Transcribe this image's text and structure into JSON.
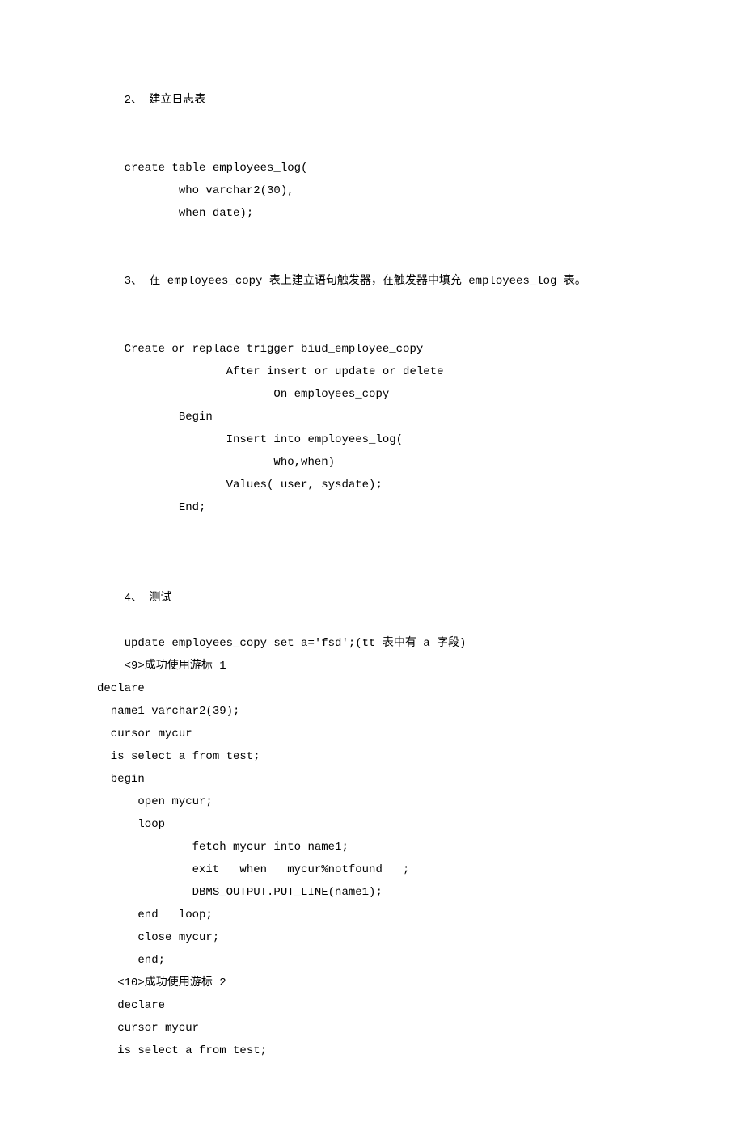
{
  "lines": {
    "l01": "    2、 建立日志表",
    "l02": "    create table employees_log(",
    "l03": "            who varchar2(30),",
    "l04": "            when date);",
    "l05": "    3、 在 employees_copy 表上建立语句触发器，在触发器中填充 employees_log 表。",
    "l06": "    Create or replace trigger biud_employee_copy",
    "l07": "                   After insert or update or delete",
    "l08": "                          On employees_copy",
    "l09": "            Begin",
    "l10": "                   Insert into employees_log(",
    "l11": "                          Who,when)",
    "l12": "                   Values( user, sysdate);",
    "l13": "            End;",
    "l14": "    4、 测试",
    "l15": "    update employees_copy set a='fsd';(tt 表中有 a 字段)",
    "l16": "    <9>成功使用游标 1",
    "l17": "declare",
    "l18": "  name1 varchar2(39);",
    "l19": "  cursor mycur",
    "l20": "  is select a from test;",
    "l21": "  begin",
    "l22": "      open mycur;",
    "l23": "      loop",
    "l24": "              fetch mycur into name1;",
    "l25": "              exit   when   mycur%notfound   ;",
    "l26": "              DBMS_OUTPUT.PUT_LINE(name1);",
    "l27": "      end   loop;",
    "l28": "      close mycur;",
    "l29": "      end;",
    "l30": "   <10>成功使用游标 2",
    "l31": "   declare",
    "l32": "   cursor mycur",
    "l33": "   is select a from test;"
  }
}
